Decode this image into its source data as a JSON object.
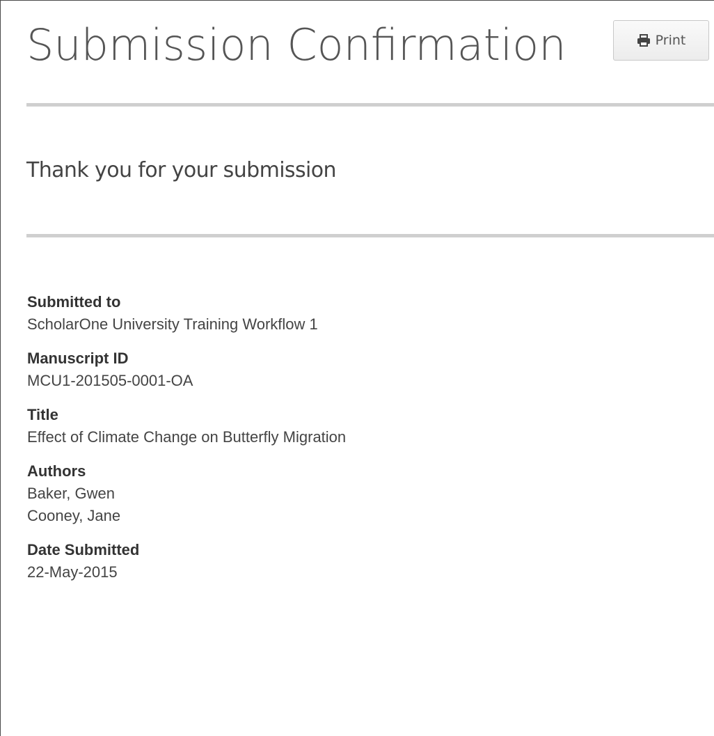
{
  "header": {
    "title": "Submission Confirmation",
    "print_label": "Print",
    "print_icon": "printer-icon"
  },
  "message": {
    "text": "Thank you for your submission"
  },
  "details": {
    "submitted_to": {
      "label": "Submitted to",
      "value": "ScholarOne University Training Workflow 1"
    },
    "manuscript_id": {
      "label": "Manuscript ID",
      "value": "MCU1-201505-0001-OA"
    },
    "title": {
      "label": "Title",
      "value": "Effect of Climate Change on Butterfly Migration"
    },
    "authors": {
      "label": "Authors",
      "values": [
        "Baker, Gwen",
        "Cooney, Jane"
      ]
    },
    "date_submitted": {
      "label": "Date Submitted",
      "value": "22-May-2015"
    }
  },
  "colors": {
    "title_text": "#555555",
    "rule": "#cfcfcf",
    "button_border": "#c8c8c8"
  }
}
